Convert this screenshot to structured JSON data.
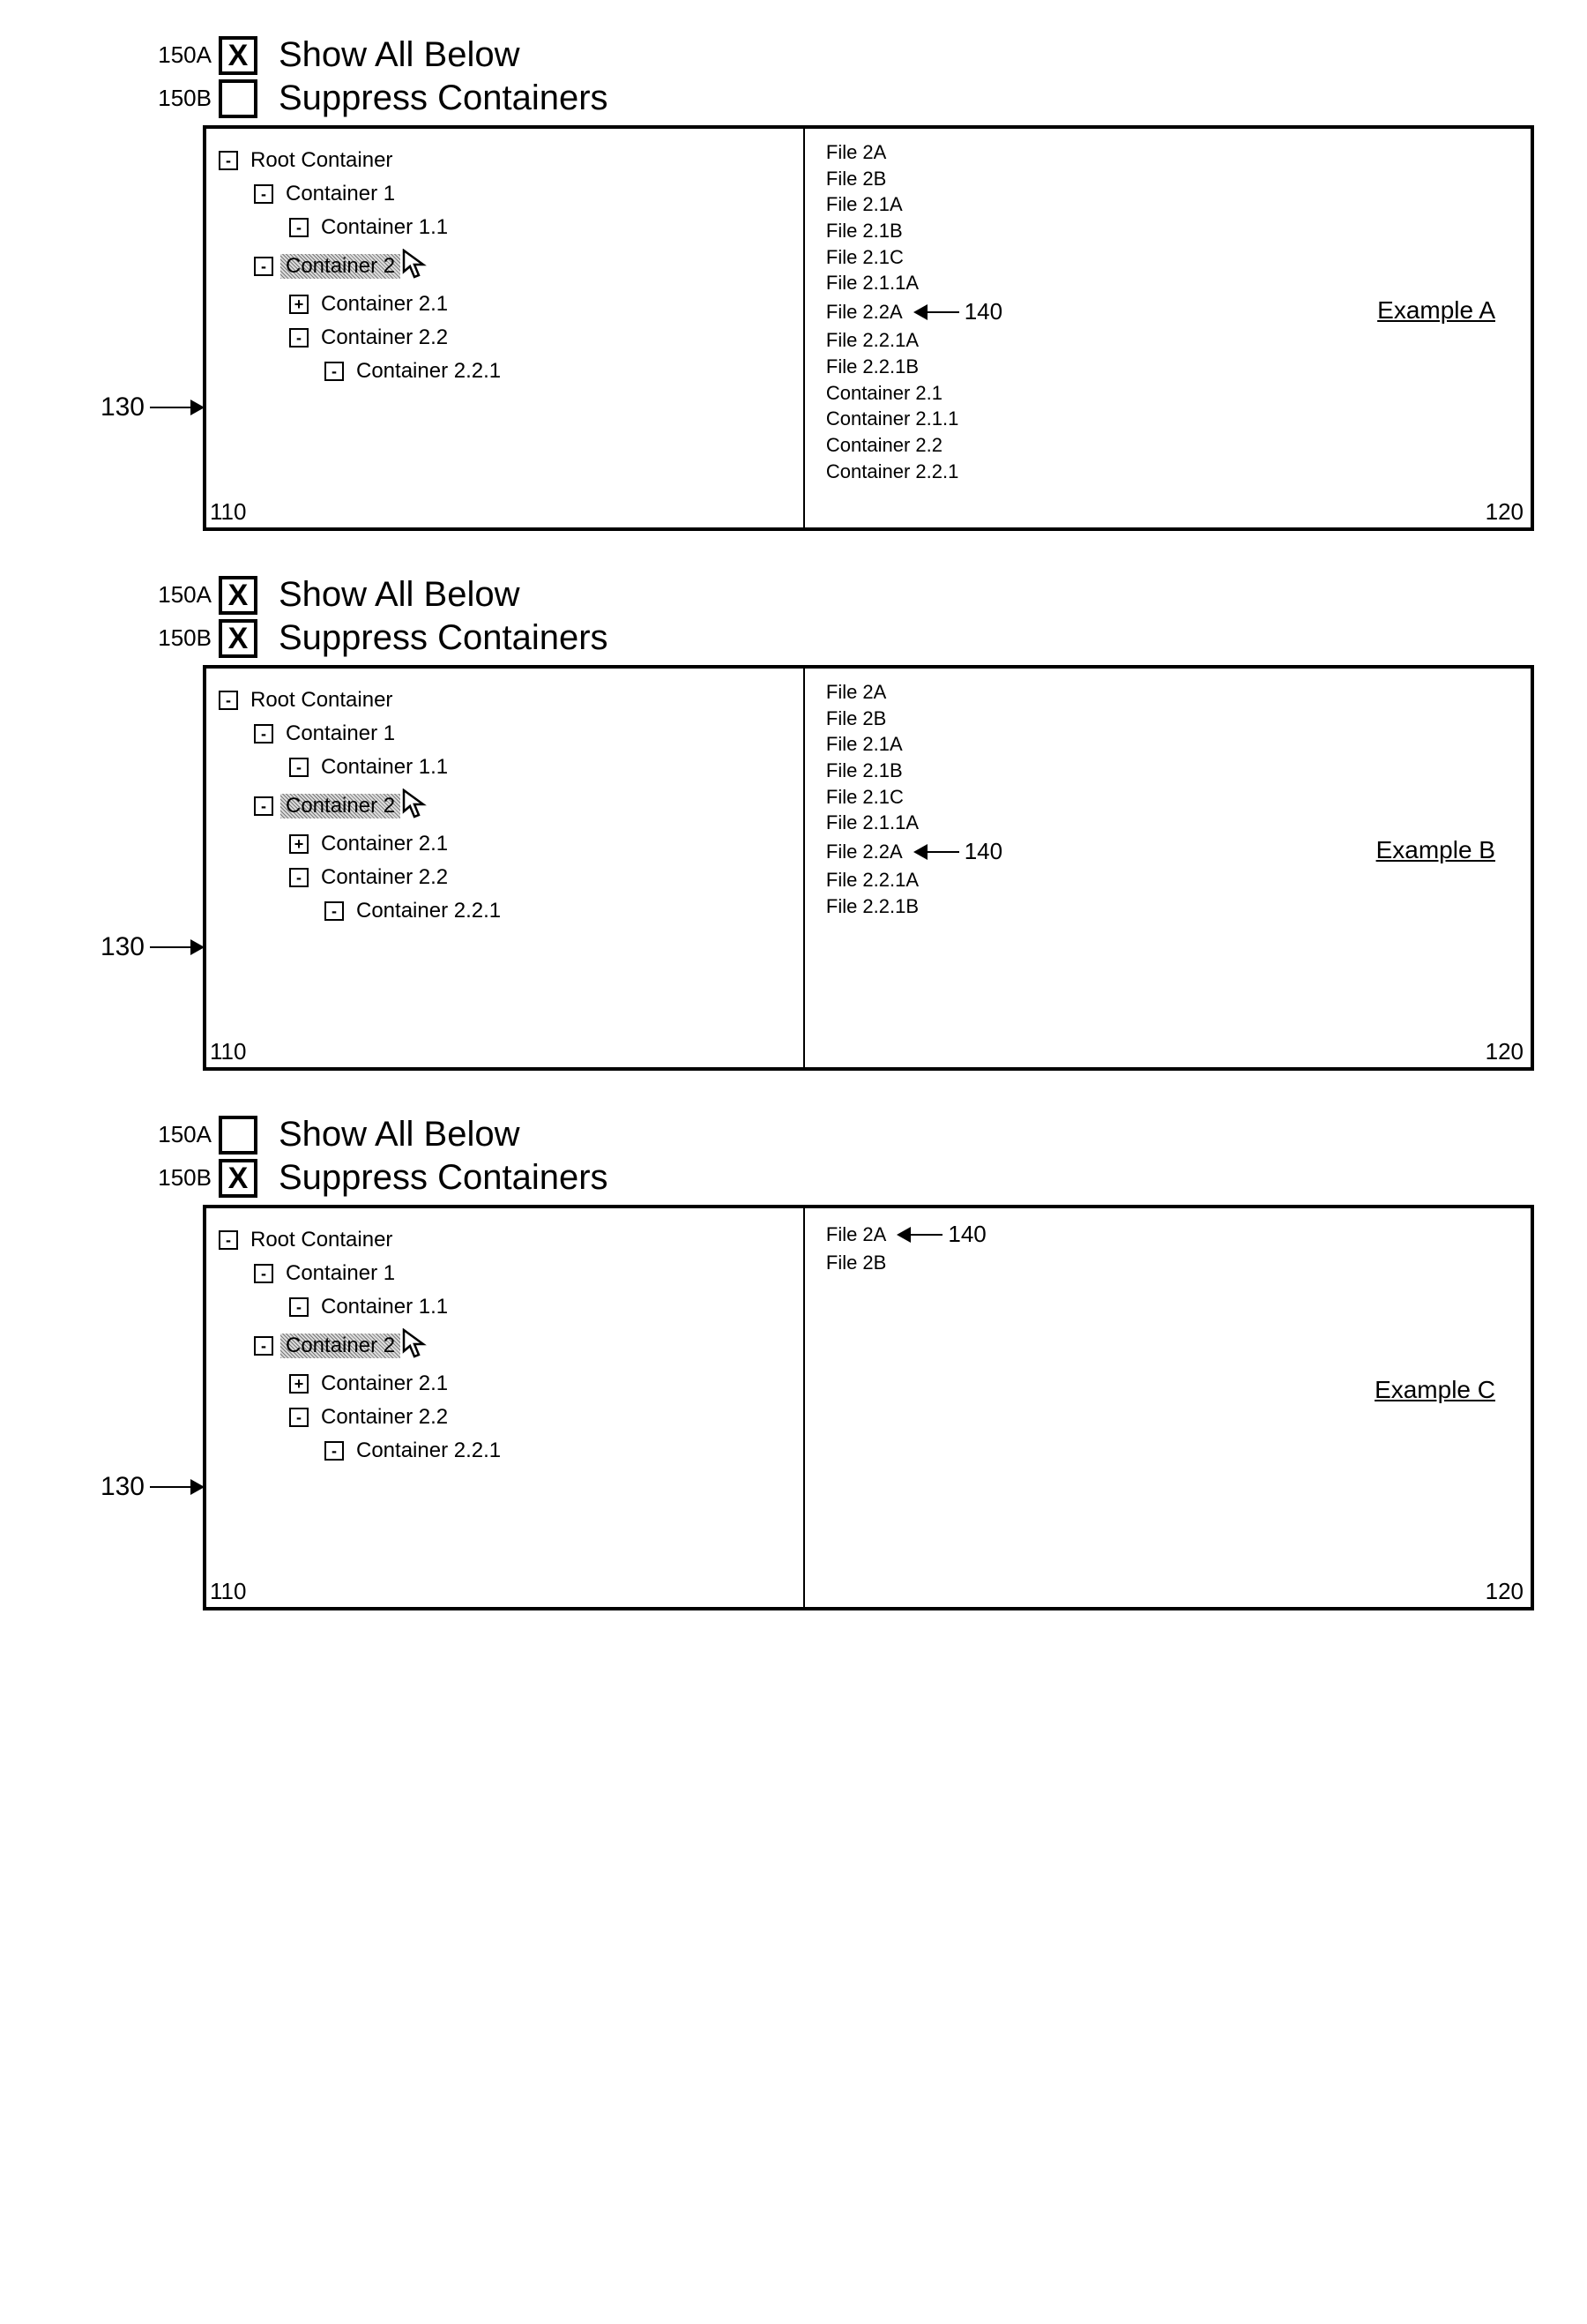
{
  "options": {
    "show_all_below": "Show All Below",
    "suppress_containers": "Suppress Containers"
  },
  "refs": {
    "r150A": "150A",
    "r150B": "150B",
    "r130": "130",
    "r140": "140",
    "r110": "110",
    "r120": "120"
  },
  "tree": {
    "root": "Root Container",
    "c1": "Container 1",
    "c11": "Container 1.1",
    "c2": "Container 2",
    "c21": "Container 2.1",
    "c22": "Container 2.2",
    "c221": "Container 2.2.1"
  },
  "examples": [
    {
      "id": "A",
      "label": "Example A",
      "show_all_below_checked": true,
      "suppress_containers_checked": false,
      "files": [
        "File 2A",
        "File 2B",
        "File 2.1A",
        "File 2.1B",
        "File 2.1C",
        "File 2.1.1A",
        "File 2.2A",
        "File 2.2.1A",
        "File 2.2.1B",
        "Container 2.1",
        "Container 2.1.1",
        "Container 2.2",
        "Container 2.2.1"
      ],
      "ref_row_index": 6
    },
    {
      "id": "B",
      "label": "Example B",
      "show_all_below_checked": true,
      "suppress_containers_checked": true,
      "files": [
        "File 2A",
        "File 2B",
        "File 2.1A",
        "File 2.1B",
        "File 2.1C",
        "File 2.1.1A",
        "File 2.2A",
        "File 2.2.1A",
        "File 2.2.1B"
      ],
      "ref_row_index": 6
    },
    {
      "id": "C",
      "label": "Example C",
      "show_all_below_checked": false,
      "suppress_containers_checked": true,
      "files": [
        "File 2A",
        "File 2B"
      ],
      "ref_row_index": 0
    }
  ],
  "glyphs": {
    "check": "X",
    "minus": "-",
    "plus": "+"
  }
}
